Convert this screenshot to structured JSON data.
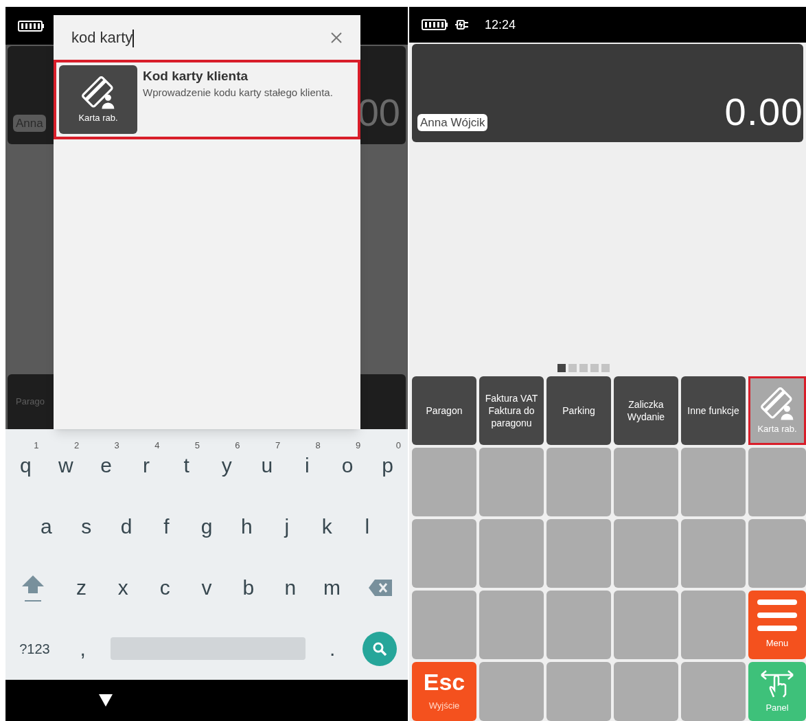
{
  "left_screen": {
    "background": {
      "customer_chip": "Anna",
      "total": "00",
      "bottom_label": "Parago"
    },
    "search_dialog": {
      "query": "kod karty",
      "results": [
        {
          "tile_label": "Karta rab.",
          "title": "Kod karty klienta",
          "description": "Wprowadzenie kodu karty stałego klienta.",
          "selected": true
        }
      ]
    },
    "keyboard": {
      "rows": [
        [
          {
            "kind": "letter",
            "label": "q",
            "hint": "1"
          },
          {
            "kind": "letter",
            "label": "w",
            "hint": "2"
          },
          {
            "kind": "letter",
            "label": "e",
            "hint": "3"
          },
          {
            "kind": "letter",
            "label": "r",
            "hint": "4"
          },
          {
            "kind": "letter",
            "label": "t",
            "hint": "5"
          },
          {
            "kind": "letter",
            "label": "y",
            "hint": "6"
          },
          {
            "kind": "letter",
            "label": "u",
            "hint": "7"
          },
          {
            "kind": "letter",
            "label": "i",
            "hint": "8"
          },
          {
            "kind": "letter",
            "label": "o",
            "hint": "9"
          },
          {
            "kind": "letter",
            "label": "p",
            "hint": "0"
          }
        ],
        [
          {
            "kind": "letter",
            "label": "a"
          },
          {
            "kind": "letter",
            "label": "s"
          },
          {
            "kind": "letter",
            "label": "d"
          },
          {
            "kind": "letter",
            "label": "f"
          },
          {
            "kind": "letter",
            "label": "g"
          },
          {
            "kind": "letter",
            "label": "h"
          },
          {
            "kind": "letter",
            "label": "j"
          },
          {
            "kind": "letter",
            "label": "k"
          },
          {
            "kind": "letter",
            "label": "l"
          }
        ],
        [
          {
            "kind": "shift"
          },
          {
            "kind": "letter",
            "label": "z"
          },
          {
            "kind": "letter",
            "label": "x"
          },
          {
            "kind": "letter",
            "label": "c"
          },
          {
            "kind": "letter",
            "label": "v"
          },
          {
            "kind": "letter",
            "label": "b"
          },
          {
            "kind": "letter",
            "label": "n"
          },
          {
            "kind": "letter",
            "label": "m"
          },
          {
            "kind": "backspace"
          }
        ],
        [
          {
            "kind": "symbols",
            "label": "?123"
          },
          {
            "kind": "letter",
            "label": ","
          },
          {
            "kind": "space"
          },
          {
            "kind": "letter",
            "label": "."
          },
          {
            "kind": "search"
          }
        ]
      ]
    }
  },
  "right_screen": {
    "status_bar": {
      "time": "12:24"
    },
    "customer_chip": "Anna Wójcik",
    "total": "0.00",
    "page_dots": [
      {
        "selected": true
      },
      {
        "selected": false
      },
      {
        "selected": false
      },
      {
        "selected": false
      },
      {
        "selected": false
      }
    ],
    "grid": [
      {
        "kind": "function",
        "lines": [
          "Paragon"
        ]
      },
      {
        "kind": "function",
        "lines": [
          "Faktura VAT",
          "Faktura do paragonu"
        ]
      },
      {
        "kind": "function",
        "lines": [
          "Parking"
        ]
      },
      {
        "kind": "function",
        "lines": [
          "Zaliczka",
          "Wydanie"
        ]
      },
      {
        "kind": "function",
        "lines": [
          "Inne funkcje"
        ]
      },
      {
        "kind": "card",
        "lines": [
          "Karta rab."
        ],
        "selected": true
      },
      {
        "kind": "empty"
      },
      {
        "kind": "empty"
      },
      {
        "kind": "empty"
      },
      {
        "kind": "empty"
      },
      {
        "kind": "empty"
      },
      {
        "kind": "empty"
      },
      {
        "kind": "empty"
      },
      {
        "kind": "empty"
      },
      {
        "kind": "empty"
      },
      {
        "kind": "empty"
      },
      {
        "kind": "empty"
      },
      {
        "kind": "empty"
      },
      {
        "kind": "empty"
      },
      {
        "kind": "empty"
      },
      {
        "kind": "empty"
      },
      {
        "kind": "empty"
      },
      {
        "kind": "empty"
      },
      {
        "kind": "menu",
        "lines": [
          "Menu"
        ]
      },
      {
        "kind": "esc",
        "lines": [
          "Esc",
          "Wyjście"
        ]
      },
      {
        "kind": "empty"
      },
      {
        "kind": "empty"
      },
      {
        "kind": "empty"
      },
      {
        "kind": "empty"
      },
      {
        "kind": "panel",
        "lines": [
          "Panel"
        ]
      }
    ]
  }
}
